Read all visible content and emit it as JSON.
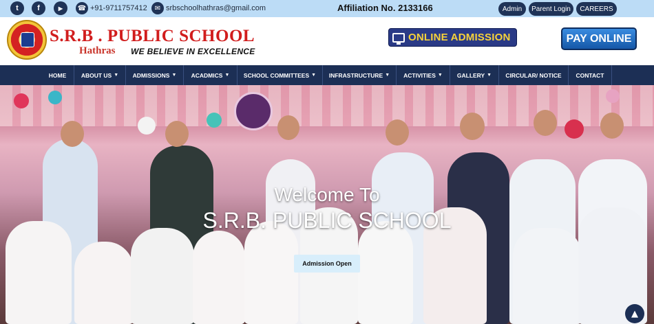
{
  "topbar": {
    "social": [
      {
        "name": "twitter-icon",
        "glyph": "t"
      },
      {
        "name": "facebook-icon",
        "glyph": "f"
      },
      {
        "name": "youtube-icon",
        "glyph": "▶"
      }
    ],
    "phone": "+91-9711757412",
    "email": "srbschoolhathras@gmail.com",
    "affiliation": "Affiliation No. 2133166",
    "buttons": [
      "Admin",
      "Parent Login",
      "CAREERS"
    ]
  },
  "header": {
    "brand_name": "S.R.B . PUBLIC SCHOOL",
    "city": "Hathras",
    "tagline": "WE BELIEVE IN EXCELLENCE",
    "online_admission": "ONLINE ADMISSION",
    "pay_online": "PAY ONLINE"
  },
  "nav": {
    "items": [
      {
        "label": "HOME",
        "dropdown": false
      },
      {
        "label": "ABOUT US",
        "dropdown": true
      },
      {
        "label": "ADMISSIONS",
        "dropdown": true
      },
      {
        "label": "ACADMICS",
        "dropdown": true
      },
      {
        "label": "SCHOOL COMMITTEES",
        "dropdown": true
      },
      {
        "label": "INFRASTRUCTURE",
        "dropdown": true
      },
      {
        "label": "ACTIVITIES",
        "dropdown": true
      },
      {
        "label": "GALLERY",
        "dropdown": true
      },
      {
        "label": "CIRCULAR/ NOTICE",
        "dropdown": false
      },
      {
        "label": "CONTACT",
        "dropdown": false
      }
    ],
    "caret": "▼"
  },
  "hero": {
    "welcome_line1": "Welcome To",
    "welcome_line2": "S.R.B. PUBLIC SCHOOL",
    "cta": "Admission Open",
    "scroll_top_glyph": "▲"
  },
  "colors": {
    "topbar": "#bcdcf6",
    "navy": "#1c2f55",
    "brand_red": "#d11d1d",
    "admission_yellow": "#f7d23a",
    "pay_blue": "#1558a8"
  }
}
